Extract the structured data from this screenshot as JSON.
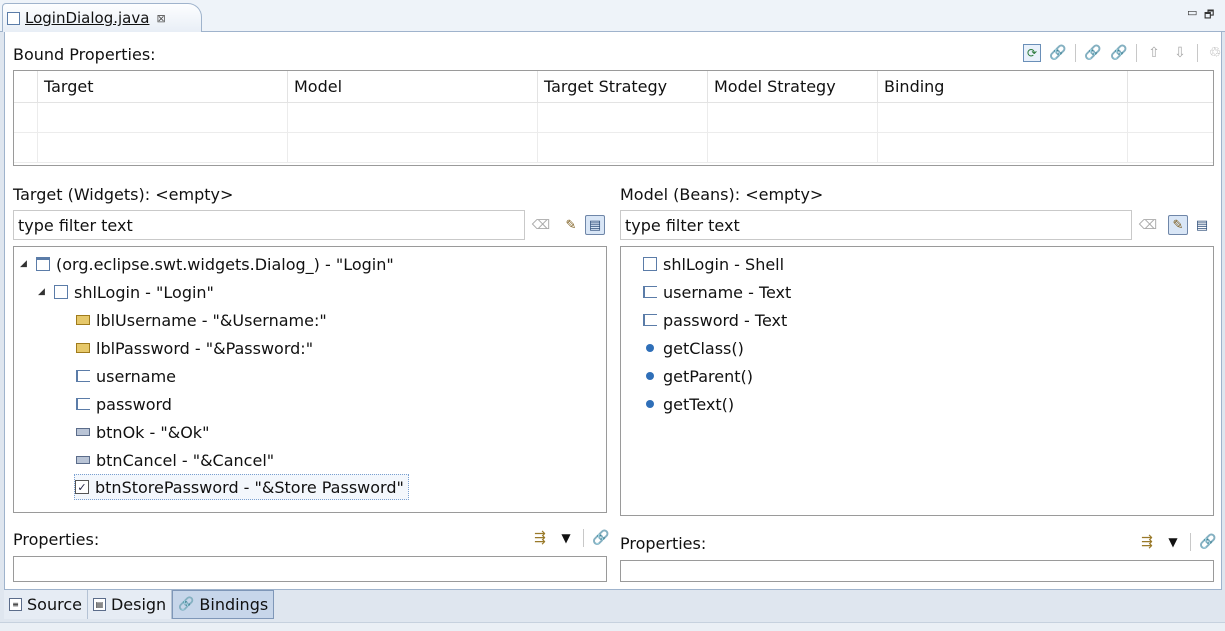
{
  "editor_tab": {
    "title": "LoginDialog.java",
    "close": "⊠"
  },
  "window_controls": {
    "minimize": "▭",
    "restore": "🗗"
  },
  "bound_properties": {
    "title": "Bound Properties:",
    "columns": [
      "Target",
      "Model",
      "Target Strategy",
      "Model Strategy",
      "Binding"
    ],
    "rows": [
      [
        "",
        "",
        "",
        "",
        ""
      ],
      [
        "",
        "",
        "",
        "",
        ""
      ]
    ],
    "toolbar_icons": [
      "refresh-icon",
      "add-binding-icon",
      "edit-binding-icon",
      "delete-binding-icon",
      "move-up-icon",
      "move-down-icon",
      "delete-all-icon"
    ]
  },
  "target_panel": {
    "title": "Target (Widgets): <empty>",
    "filter_placeholder": "type filter text",
    "tree": [
      {
        "label": "(org.eclipse.swt.widgets.Dialog_) - \"Login\"",
        "icon": "dialog-icon",
        "level": 0,
        "expanded": true
      },
      {
        "label": "shlLogin - \"Login\"",
        "icon": "shell-icon",
        "level": 1,
        "expanded": true
      },
      {
        "label": "lblUsername - \"&Username:\"",
        "icon": "label-icon",
        "level": 2
      },
      {
        "label": "lblPassword - \"&Password:\"",
        "icon": "label-icon",
        "level": 2
      },
      {
        "label": "username",
        "icon": "text-icon",
        "level": 2
      },
      {
        "label": "password",
        "icon": "text-icon",
        "level": 2
      },
      {
        "label": "btnOk - \"&Ok\"",
        "icon": "button-icon",
        "level": 2
      },
      {
        "label": "btnCancel - \"&Cancel\"",
        "icon": "button-icon",
        "level": 2
      },
      {
        "label": "btnStorePassword - \"&Store Password\"",
        "icon": "checkbox-icon",
        "level": 2,
        "selected": true
      }
    ],
    "properties_label": "Properties:"
  },
  "model_panel": {
    "title": "Model (Beans): <empty>",
    "filter_placeholder": "type filter text",
    "tree": [
      {
        "label": "shlLogin - Shell",
        "icon": "shell-icon"
      },
      {
        "label": "username - Text",
        "icon": "text-icon"
      },
      {
        "label": "password - Text",
        "icon": "text-icon"
      },
      {
        "label": "getClass()",
        "icon": "method-icon"
      },
      {
        "label": "getParent()",
        "icon": "method-icon"
      },
      {
        "label": "getText()",
        "icon": "method-icon"
      }
    ],
    "properties_label": "Properties:"
  },
  "bottom_tabs": [
    {
      "label": "Source",
      "active": false
    },
    {
      "label": "Design",
      "active": false
    },
    {
      "label": "Bindings",
      "active": true
    }
  ]
}
